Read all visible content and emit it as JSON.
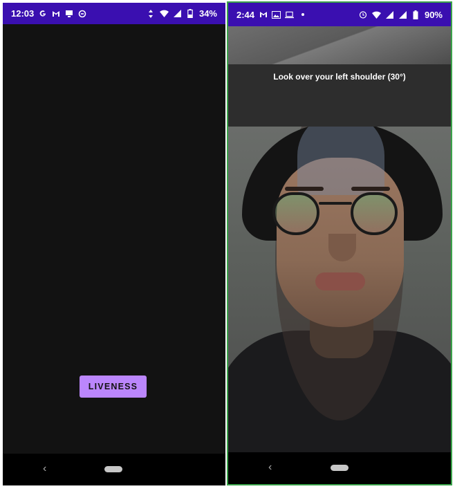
{
  "left_screen": {
    "status_bar": {
      "time": "12:03",
      "notification_icons": [
        "google-icon",
        "gmail-icon",
        "tv-icon",
        "sync-icon"
      ],
      "system_icons": [
        "data-arrows-icon",
        "wifi-icon",
        "signal-icon",
        "battery-icon"
      ],
      "battery": "34%"
    },
    "button_label": "LIVENESS",
    "colors": {
      "status_bar": "#3a0fb0",
      "background": "#121212",
      "button": "#bb86fc"
    }
  },
  "right_screen": {
    "status_bar": {
      "time": "2:44",
      "notification_icons": [
        "gmail-icon",
        "image-icon",
        "laptop-icon",
        "dot-icon"
      ],
      "system_icons": [
        "alarm-icon",
        "wifi-icon",
        "signal-icon",
        "signal-icon",
        "battery-icon"
      ],
      "battery": "90%"
    },
    "prompt": "Look over your left shoulder (30°)",
    "colors": {
      "status_bar": "#3a0fb0",
      "border": "#3aa24a"
    }
  },
  "nav": {
    "back_glyph": "‹"
  }
}
